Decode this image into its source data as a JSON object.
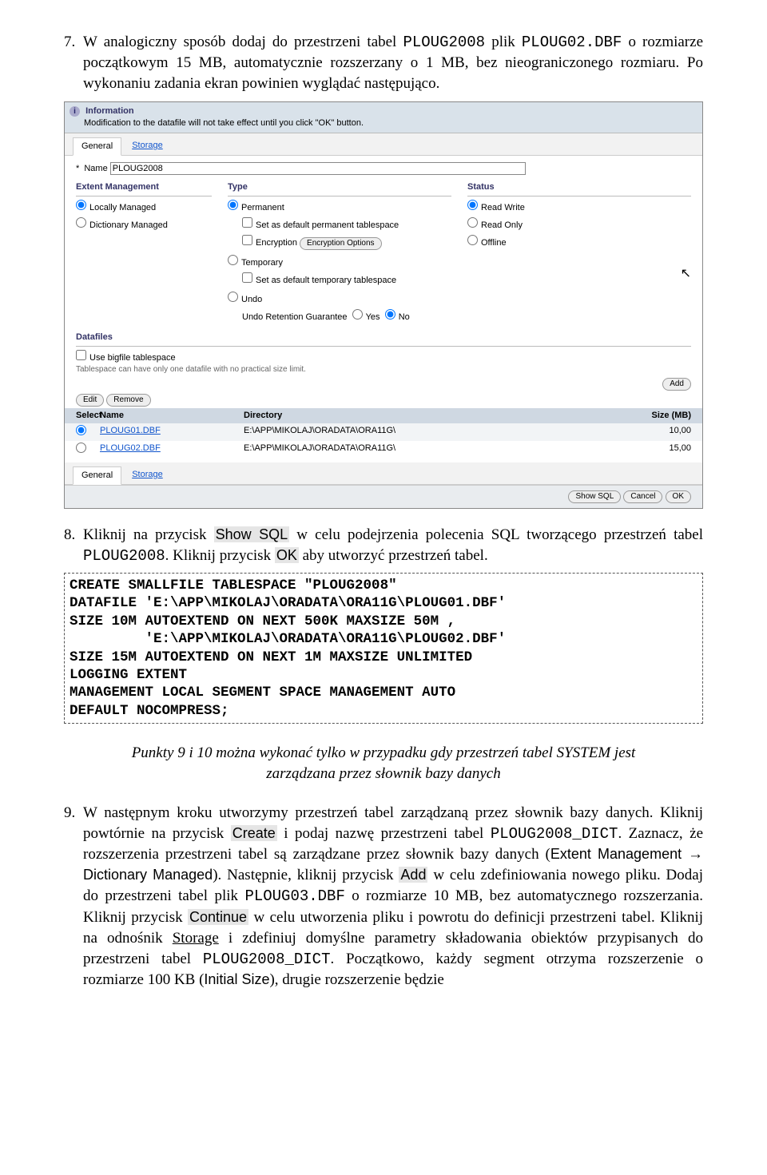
{
  "p7": {
    "num": "7.",
    "l1": "W analogiczny sposób dodaj do przestrzeni tabel ",
    "code1": "PLOUG2008",
    "l2": " plik ",
    "code2": "PLOUG02.DBF",
    "l3": "o rozmiarze początkowym 15 MB, automatycznie rozszerzany o 1 MB, bez nieograniczonego rozmiaru. Po wykonaniu zadania ekran powinien wyglądać następująco."
  },
  "shot": {
    "info_title": "Information",
    "info_text": "Modification to the datafile will not take effect until you click \"OK\" button.",
    "tab_general": "General",
    "tab_storage": "Storage",
    "name_label": "Name",
    "name_value": "PLOUG2008",
    "extent_header": "Extent Management",
    "extent_local": "Locally Managed",
    "extent_dict": "Dictionary Managed",
    "type_header": "Type",
    "type_perm": "Permanent",
    "type_perm_cb": "Set as default permanent tablespace",
    "enc_label": "Encryption",
    "enc_btn": "Encryption Options",
    "type_temp": "Temporary",
    "type_temp_cb": "Set as default temporary tablespace",
    "type_undo": "Undo",
    "undo_ret": "Undo Retention Guarantee",
    "yes": "Yes",
    "no": "No",
    "status_header": "Status",
    "status_rw": "Read Write",
    "status_ro": "Read Only",
    "status_off": "Offline",
    "df_header": "Datafiles",
    "bigfile_cb": "Use bigfile tablespace",
    "bigfile_note": "Tablespace can have only one datafile with no practical size limit.",
    "add_btn": "Add",
    "edit_btn": "Edit",
    "remove_btn": "Remove",
    "col_select": "Select",
    "col_name": "Name",
    "col_dir": "Directory",
    "col_size": "Size (MB)",
    "r1_name": "PLOUG01.DBF",
    "r1_dir": "E:\\APP\\MIKOLAJ\\ORADATA\\ORA11G\\",
    "r1_size": "10,00",
    "r2_name": "PLOUG02.DBF",
    "r2_dir": "E:\\APP\\MIKOLAJ\\ORADATA\\ORA11G\\",
    "r2_size": "15,00",
    "show_sql_btn": "Show SQL",
    "cancel_btn": "Cancel",
    "ok_btn": "OK"
  },
  "p8": {
    "num": "8.",
    "t1": "Kliknij na przycisk ",
    "b1": "Show SQL",
    "t2": " w celu podejrzenia polecenia SQL tworzącego przestrzeń tabel ",
    "code1": "PLOUG2008",
    "t3": ". Kliknij przycisk ",
    "b2": "OK",
    "t4": " aby utworzyć przestrzeń tabel."
  },
  "sql": "CREATE SMALLFILE TABLESPACE \"PLOUG2008\"\nDATAFILE 'E:\\APP\\MIKOLAJ\\ORADATA\\ORA11G\\PLOUG01.DBF'\nSIZE 10M AUTOEXTEND ON NEXT 500K MAXSIZE 50M ,\n         'E:\\APP\\MIKOLAJ\\ORADATA\\ORA11G\\PLOUG02.DBF'\nSIZE 15M AUTOEXTEND ON NEXT 1M MAXSIZE UNLIMITED\nLOGGING EXTENT\nMANAGEMENT LOCAL SEGMENT SPACE MANAGEMENT AUTO\nDEFAULT NOCOMPRESS;",
  "italic": "Punkty 9 i 10 można wykonać tylko w przypadku gdy przestrzeń tabel SYSTEM jest zarządzana przez słownik bazy danych",
  "p9": {
    "num": "9.",
    "t1": "W następnym kroku utworzymy przestrzeń tabel zarządzaną przez słownik bazy danych. Kliknij powtórnie na przycisk ",
    "b_create": "Create",
    "t2": " i podaj nazwę przestrzeni tabel ",
    "code_dict": "PLOUG2008_DICT",
    "t3": ". Zaznacz, że rozszerzenia przestrzeni tabel są zarządzane przez słownik bazy danych (",
    "s_ext": "Extent Management",
    "arrow": " → ",
    "s_dict": "Dictionary Managed",
    "t4": "). Następnie, kliknij przycisk ",
    "b_add": "Add",
    "t5": " w celu zdefiniowania nowego pliku. Dodaj do przestrzeni tabel plik ",
    "code_p3": "PLOUG03.DBF",
    "t6": " o rozmiarze 10 MB, bez automatycznego rozszerzania. Kliknij przycisk ",
    "b_cont": "Continue",
    "t7": " w celu utworzenia pliku i powrotu do definicji przestrzeni tabel. Kliknij na odnośnik ",
    "u_storage": "Storage",
    "t8": " i zdefiniuj domyślne parametry składowania obiektów przypisanych do przestrzeni tabel ",
    "t9": ". Początkowo, każdy segment otrzyma rozszerzenie o rozmiarze 100 KB (",
    "s_init": "Initial Size",
    "t10": "), drugie rozszerzenie będzie"
  }
}
